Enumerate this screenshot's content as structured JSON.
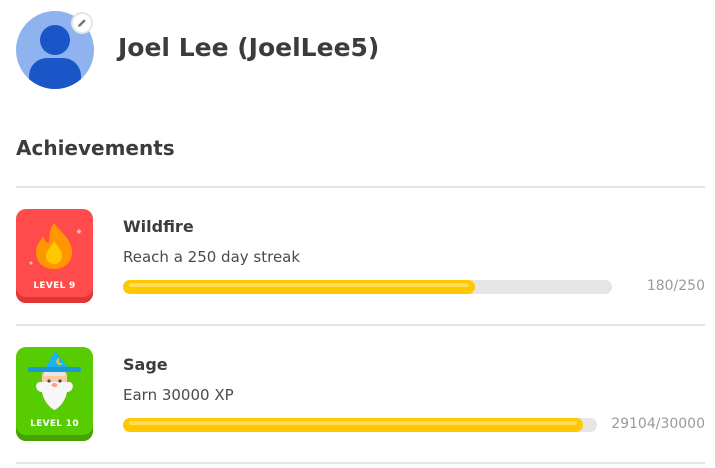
{
  "profile": {
    "display_name": "Joel Lee (JoelLee5)",
    "avatar_icon": "user-silhouette-icon",
    "edit_icon": "pencil-icon"
  },
  "achievements_title": "Achievements",
  "achievements": [
    {
      "title": "Wildfire",
      "description": "Reach a 250 day streak",
      "level": "LEVEL 9",
      "progress_text": "180/250",
      "progress_fraction": 0.72,
      "badge_icon": "flame-icon",
      "badge_color": "#ff4b4b"
    },
    {
      "title": "Sage",
      "description": "Earn 30000 XP",
      "level": "LEVEL 10",
      "progress_text": "29104/30000",
      "progress_fraction": 0.97,
      "badge_icon": "wizard-icon",
      "badge_color": "#58cc02"
    }
  ],
  "colors": {
    "progress_fill": "#ffc800",
    "progress_track": "#e5e5e5"
  }
}
